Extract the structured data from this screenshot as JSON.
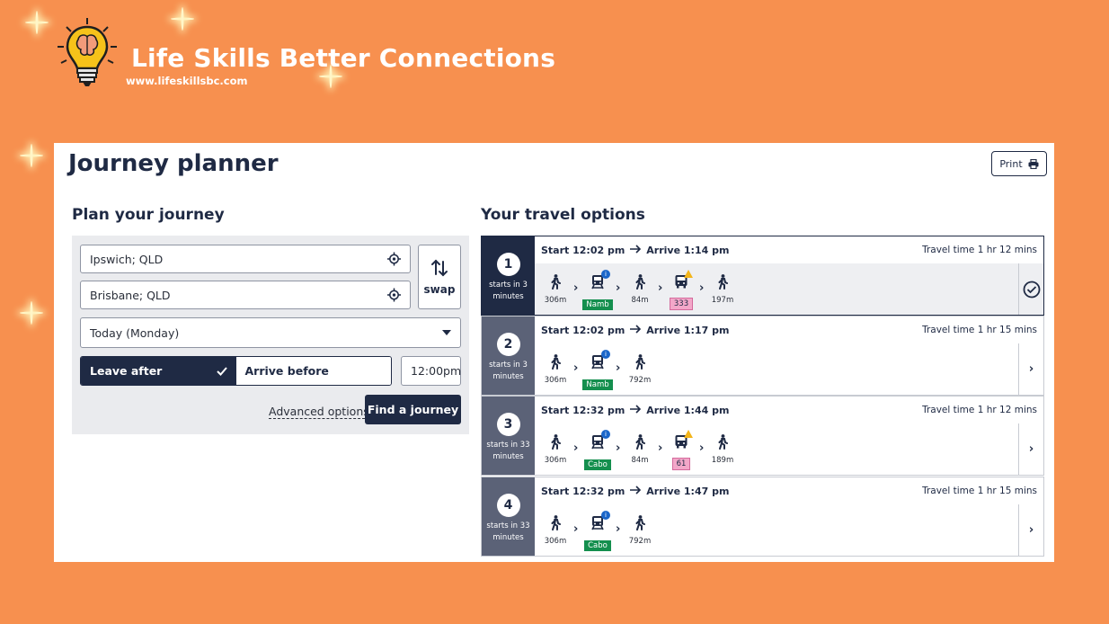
{
  "brand": {
    "name": "Life Skills Better Connections",
    "url": "www.lifeskillsbc.com"
  },
  "page": {
    "title": "Journey planner",
    "print_label": "Print"
  },
  "plan": {
    "heading": "Plan your journey",
    "from": "Ipswich; QLD",
    "to": "Brisbane; QLD",
    "swap_label": "swap",
    "date": "Today (Monday)",
    "leave_after": "Leave after",
    "arrive_before": "Arrive before",
    "time": "12:00pm",
    "advanced": "Advanced options",
    "find": "Find a journey"
  },
  "options": {
    "heading": "Your travel options",
    "items": [
      {
        "num": "1",
        "starts": "starts in 3 minutes",
        "start": "Start 12:02 pm",
        "arrive": "Arrive 1:14 pm",
        "travel": "Travel time 1 hr 12 mins",
        "legs": [
          {
            "mode": "walk",
            "label": "306m"
          },
          {
            "mode": "train",
            "label": "Namb"
          },
          {
            "mode": "walk",
            "label": "84m"
          },
          {
            "mode": "bus",
            "label": "333"
          },
          {
            "mode": "walk",
            "label": "197m"
          }
        ]
      },
      {
        "num": "2",
        "starts": "starts in 3 minutes",
        "start": "Start 12:02 pm",
        "arrive": "Arrive 1:17 pm",
        "travel": "Travel time 1 hr 15 mins",
        "legs": [
          {
            "mode": "walk",
            "label": "306m"
          },
          {
            "mode": "train",
            "label": "Namb"
          },
          {
            "mode": "walk",
            "label": "792m"
          }
        ]
      },
      {
        "num": "3",
        "starts": "starts in 33 minutes",
        "start": "Start 12:32 pm",
        "arrive": "Arrive 1:44 pm",
        "travel": "Travel time 1 hr 12 mins",
        "legs": [
          {
            "mode": "walk",
            "label": "306m"
          },
          {
            "mode": "train",
            "label": "Cabo"
          },
          {
            "mode": "walk",
            "label": "84m"
          },
          {
            "mode": "bus",
            "label": "61"
          },
          {
            "mode": "walk",
            "label": "189m"
          }
        ]
      },
      {
        "num": "4",
        "starts": "starts in 33 minutes",
        "start": "Start 12:32 pm",
        "arrive": "Arrive 1:47 pm",
        "travel": "Travel time 1 hr 15 mins",
        "legs": [
          {
            "mode": "walk",
            "label": "306m"
          },
          {
            "mode": "train",
            "label": "Cabo"
          },
          {
            "mode": "walk",
            "label": "792m"
          }
        ]
      }
    ]
  },
  "colors": {
    "background": "#f7904f",
    "navy": "#1f2a44",
    "train_tag": "#148f4e",
    "bus_tag": "#f3a7c9"
  }
}
